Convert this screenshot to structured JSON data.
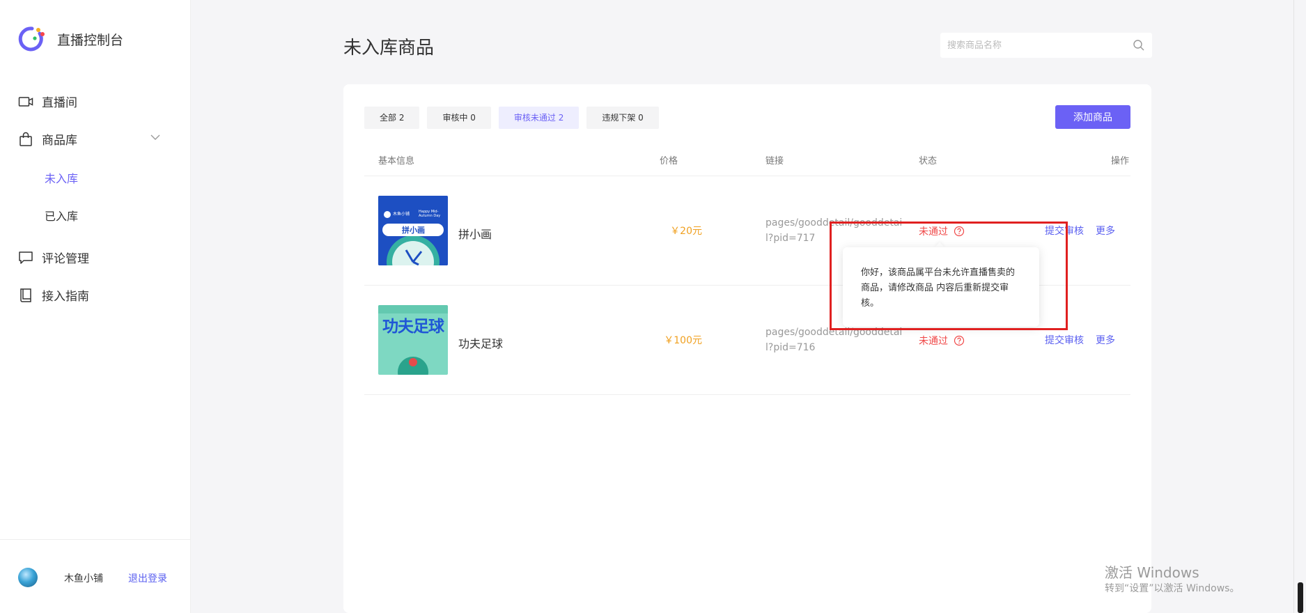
{
  "sidebar": {
    "brand_title": "直播控制台",
    "items": [
      {
        "label": "直播间",
        "icon": "video-camera-icon"
      },
      {
        "label": "商品库",
        "icon": "shopping-bag-icon"
      },
      {
        "label": "评论管理",
        "icon": "comment-icon"
      },
      {
        "label": "接入指南",
        "icon": "book-icon"
      }
    ],
    "sub_items": [
      {
        "label": "未入库",
        "active": true
      },
      {
        "label": "已入库",
        "active": false
      }
    ],
    "user": {
      "name": "木鱼小铺",
      "logout": "退出登录"
    }
  },
  "header": {
    "title": "未入库商品",
    "search_placeholder": "搜索商品名称"
  },
  "tabs": [
    {
      "label": "全部 2",
      "active": false
    },
    {
      "label": "审核中 0",
      "active": false
    },
    {
      "label": "审核未通过 2",
      "active": true
    },
    {
      "label": "违规下架 0",
      "active": false
    }
  ],
  "add_button": "添加商品",
  "table": {
    "columns": [
      "基本信息",
      "价格",
      "链接",
      "状态",
      "操作"
    ],
    "rows": [
      {
        "name": "拼小画",
        "price": "￥20元",
        "link": "pages/gooddetail/gooddetail?pid=717",
        "status": "未通过",
        "action_submit": "提交审核",
        "action_more": "更多",
        "thumb_caption": "拼小画",
        "thumb_brand": "木鱼小铺",
        "thumb_tag": "Happy Mid-Autumn Day"
      },
      {
        "name": "功夫足球",
        "price": "￥100元",
        "link": "pages/gooddetail/gooddetail?pid=716",
        "status": "未通过",
        "action_submit": "提交审核",
        "action_more": "更多",
        "thumb_caption": "功夫足球"
      }
    ]
  },
  "tooltip": {
    "text": "你好，该商品属平台未允许直播售卖的商品，请修改商品 内容后重新提交审核。"
  },
  "watermark": {
    "title": "激活 Windows",
    "subtitle": "转到“设置”以激活 Windows。"
  },
  "colors": {
    "accent": "#6b61f5",
    "link": "#5a5ff0",
    "price": "#f0a020",
    "error": "#f04848",
    "highlight": "#e02020"
  }
}
